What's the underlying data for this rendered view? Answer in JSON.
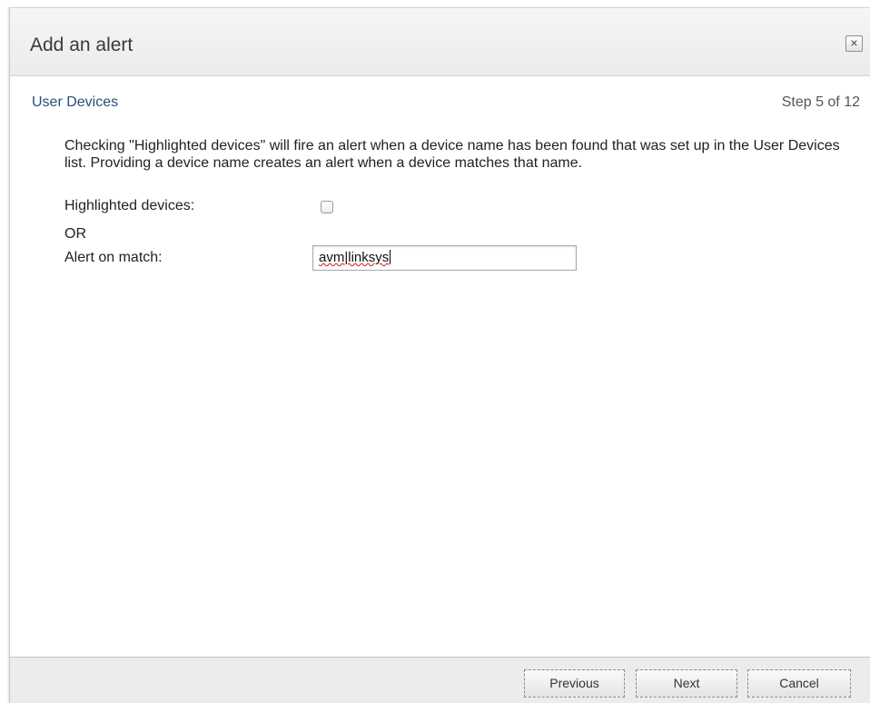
{
  "dialog": {
    "title": "Add an alert",
    "close_glyph": "×"
  },
  "step": {
    "section_title": "User Devices",
    "step_label": "Step 5 of 12"
  },
  "form": {
    "description": "Checking \"Highlighted devices\" will fire an alert when a device name has been found that was set up in the User Devices list. Providing a device name creates an alert when a device matches that name.",
    "highlighted_label": "Highlighted devices:",
    "highlighted_checked": false,
    "or_label": "OR",
    "match_label": "Alert on match:",
    "match_value": "avm|linksys"
  },
  "footer": {
    "previous_label": "Previous",
    "next_label": "Next",
    "cancel_label": "Cancel"
  },
  "colors": {
    "section_title": "#2c4d7c",
    "footer_bg": "#ececec"
  },
  "icons": {
    "close": "close-icon"
  }
}
